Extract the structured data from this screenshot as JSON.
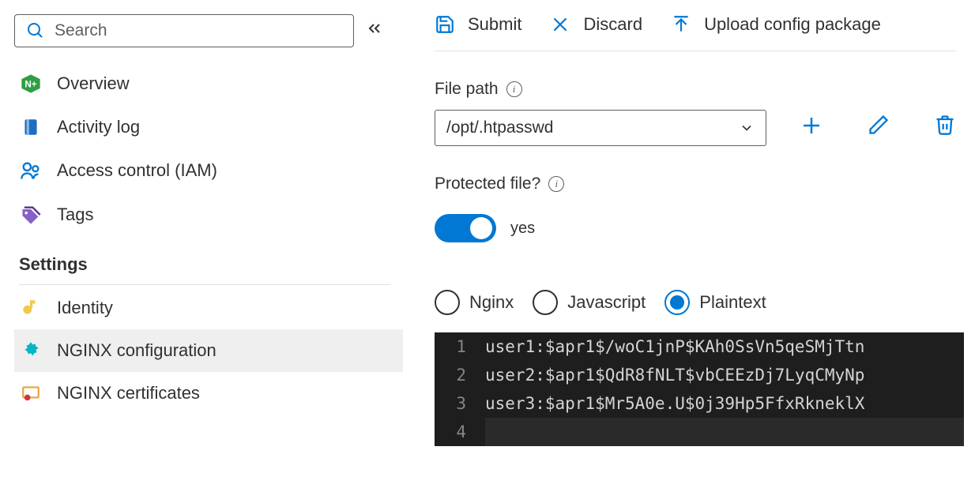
{
  "sidebar": {
    "search_placeholder": "Search",
    "items": [
      {
        "label": "Overview"
      },
      {
        "label": "Activity log"
      },
      {
        "label": "Access control (IAM)"
      },
      {
        "label": "Tags"
      }
    ],
    "settings_label": "Settings",
    "settings_items": [
      {
        "label": "Identity"
      },
      {
        "label": "NGINX configuration"
      },
      {
        "label": "NGINX certificates"
      }
    ]
  },
  "toolbar": {
    "submit": "Submit",
    "discard": "Discard",
    "upload": "Upload config package"
  },
  "filepath": {
    "label": "File path",
    "value": "/opt/.htpasswd"
  },
  "protected": {
    "label": "Protected file?",
    "value_label": "yes"
  },
  "syntax": {
    "options": [
      "Nginx",
      "Javascript",
      "Plaintext"
    ],
    "selected": "Plaintext"
  },
  "editor": {
    "lines": [
      "user1:$apr1$/woC1jnP$KAh0SsVn5qeSMjTtn",
      "user2:$apr1$QdR8fNLT$vbCEEzDj7LyqCMyNp",
      "user3:$apr1$Mr5A0e.U$0j39Hp5FfxRkneklX",
      ""
    ]
  }
}
